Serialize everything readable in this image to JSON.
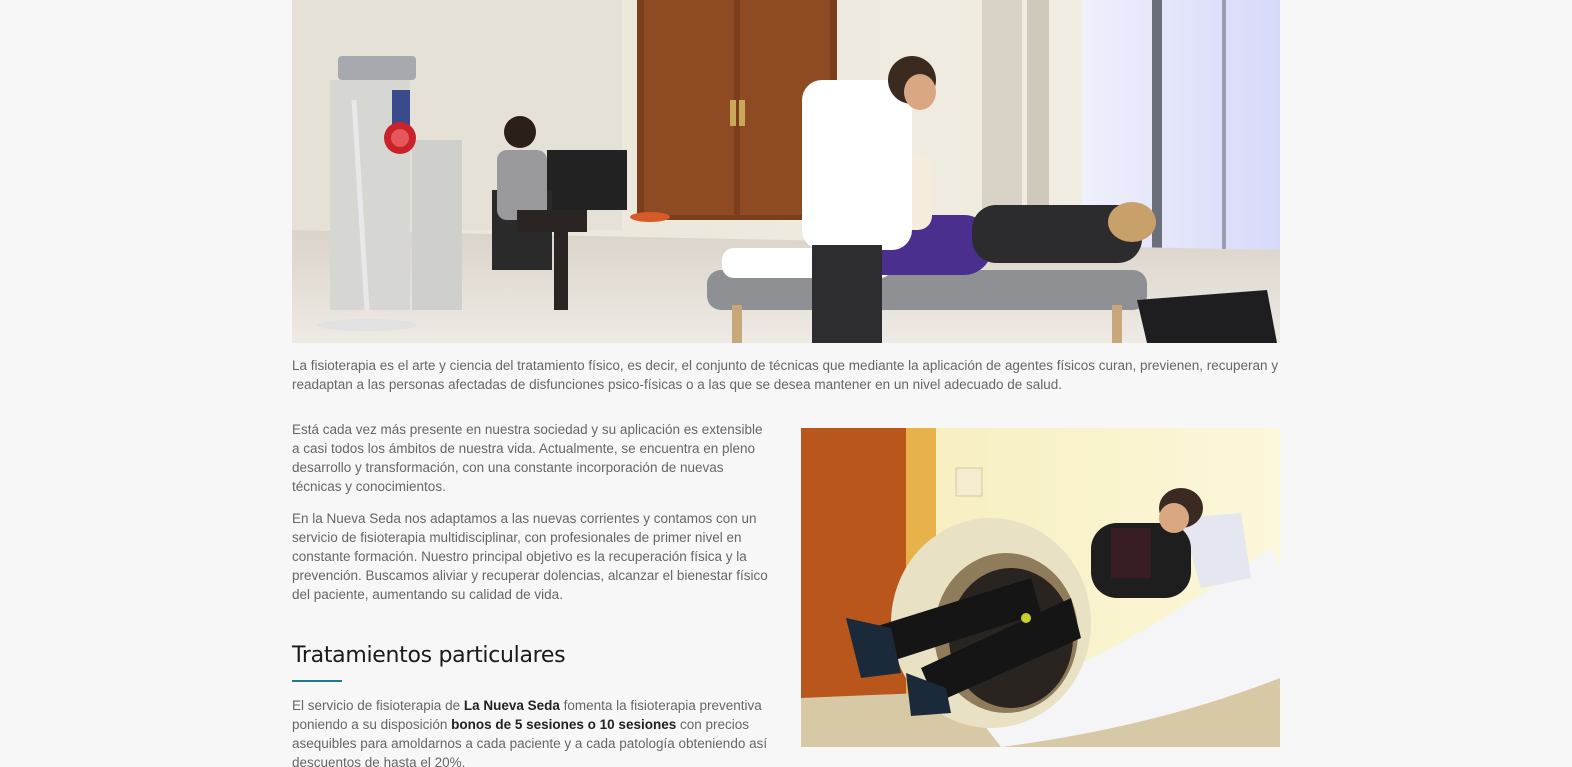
{
  "hero_image": {
    "icon": "photo-physiotherapy-session"
  },
  "intro": {
    "text": "La fisioterapia es el arte y ciencia del tratamiento físico, es decir, el conjunto de técnicas que mediante la aplicación de agentes físicos curan, previenen, recuperan y readaptan a las personas afectadas de disfunciones psico-físicas o a las que se desea mantener en un nivel adecuado de salud."
  },
  "body": {
    "paragraph_1": "Está cada vez más presente en nuestra sociedad y su aplicación es extensible a casi todos los ámbitos de nuestra vida. Actualmente, se encuentra en pleno desarrollo y transformación, con una constante incorporación de nuevas técnicas y conocimientos.",
    "paragraph_2": "En la Nueva Seda nos adaptamos a las nuevas corrientes y contamos con un servicio de fisioterapia multidisciplinar, con profesionales de primer nivel en constante formación. Nuestro principal objetivo es la recuperación física y la prevención. Buscamos aliviar y recuperar dolencias, alcanzar el bienestar físico del paciente, aumentando su calidad de vida."
  },
  "treatments": {
    "title": "Tratamientos particulares",
    "text_1": "El servicio de fisioterapia de ",
    "brand": "La Nueva Seda",
    "text_2": " fomenta la fisioterapia preventiva poniendo a su disposición ",
    "highlight": "bonos de 5 sesiones o 10 sesiones",
    "text_3": " con precios asequibles para amoldarnos a cada paciente y a cada patología obteniendo así descuentos de hasta el 20%."
  },
  "side_image": {
    "icon": "photo-magnetotherapy-device"
  },
  "colors": {
    "background": "#f7f7f7",
    "body_text": "#666666",
    "heading": "#1a1a1a",
    "accent": "#1f7a8c"
  }
}
